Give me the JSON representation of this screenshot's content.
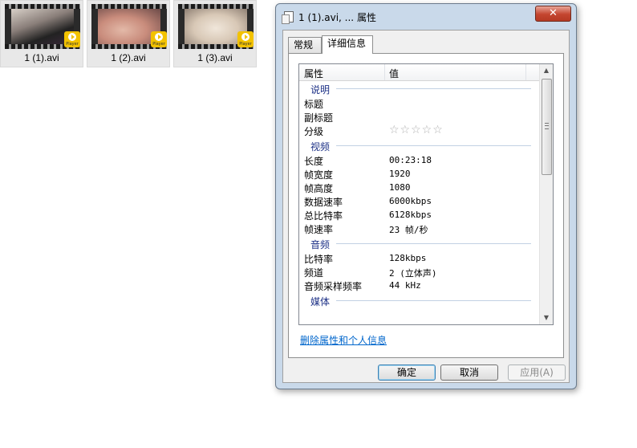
{
  "thumbnails": [
    {
      "label": "1 (1).avi",
      "badge": "Player"
    },
    {
      "label": "1 (2).avi",
      "badge": "Player"
    },
    {
      "label": "1 (3).avi",
      "badge": "Player"
    }
  ],
  "dialog": {
    "title": "1 (1).avi, ... 属性",
    "close_glyph": "✕",
    "tabs": [
      {
        "label": "常规",
        "active": false
      },
      {
        "label": "详细信息",
        "active": true
      }
    ],
    "columns": {
      "name": "属性",
      "value": "值"
    },
    "groups": {
      "description": {
        "title": "说明",
        "rows": [
          {
            "key": "标题",
            "value": ""
          },
          {
            "key": "副标题",
            "value": ""
          },
          {
            "key": "分级",
            "value": "☆☆☆☆☆"
          }
        ]
      },
      "video": {
        "title": "视频",
        "rows": [
          {
            "key": "长度",
            "value": "00:23:18"
          },
          {
            "key": "帧宽度",
            "value": "1920"
          },
          {
            "key": "帧高度",
            "value": "1080"
          },
          {
            "key": "数据速率",
            "value": "6000kbps"
          },
          {
            "key": "总比特率",
            "value": "6128kbps"
          },
          {
            "key": "帧速率",
            "value": "23 帧/秒"
          }
        ]
      },
      "audio": {
        "title": "音频",
        "rows": [
          {
            "key": "比特率",
            "value": "128kbps"
          },
          {
            "key": "频道",
            "value": "2 (立体声)"
          },
          {
            "key": "音频采样频率",
            "value": "44 kHz"
          }
        ]
      },
      "media": {
        "title": "媒体"
      }
    },
    "remove_link": "删除属性和个人信息",
    "buttons": {
      "ok": "确定",
      "cancel": "取消",
      "apply": "应用(A)"
    }
  }
}
